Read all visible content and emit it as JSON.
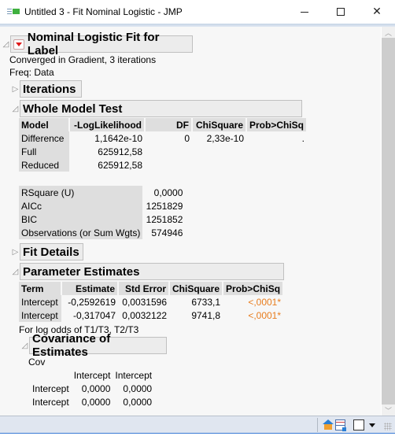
{
  "window": {
    "title": "Untitled 3 - Fit Nominal Logistic - JMP",
    "minimize_icon": "minimize-icon",
    "maximize_icon": "maximize-icon",
    "close_icon": "close-icon"
  },
  "report": {
    "main_title": "Nominal Logistic Fit for Label",
    "converged_text": "Converged in Gradient, 3 iterations",
    "freq_text": "Freq: Data",
    "iterations_title": "Iterations",
    "whole_model_test": {
      "title": "Whole Model Test",
      "columns": [
        "Model",
        "-LogLikelihood",
        "DF",
        "ChiSquare",
        "Prob>ChiSq"
      ],
      "rows": [
        {
          "model": "Difference",
          "loglik": "1,1642e-10",
          "df": "0",
          "chisq": "2,33e-10",
          "prob": "."
        },
        {
          "model": "Full",
          "loglik": "625912,58",
          "df": "",
          "chisq": "",
          "prob": ""
        },
        {
          "model": "Reduced",
          "loglik": "625912,58",
          "df": "",
          "chisq": "",
          "prob": ""
        }
      ],
      "stats": [
        {
          "label": "RSquare (U)",
          "value": "0,0000"
        },
        {
          "label": "AICc",
          "value": "1251829"
        },
        {
          "label": "BIC",
          "value": "1251852"
        },
        {
          "label": "Observations (or Sum Wgts)",
          "value": "574946"
        }
      ]
    },
    "fit_details_title": "Fit Details",
    "parameter_estimates": {
      "title": "Parameter Estimates",
      "columns": [
        "Term",
        "Estimate",
        "Std Error",
        "ChiSquare",
        "Prob>ChiSq"
      ],
      "rows": [
        {
          "term": "Intercept",
          "estimate": "-0,2592619",
          "stderr": "0,0031596",
          "chisq": "6733,1",
          "prob": "<,0001*"
        },
        {
          "term": "Intercept",
          "estimate": "-0,317047",
          "stderr": "0,0032122",
          "chisq": "9741,8",
          "prob": "<,0001*"
        }
      ],
      "footnote": "For log odds of T1/T3, T2/T3"
    },
    "covariance": {
      "title": "Covariance of Estimates",
      "label": "Cov",
      "columns": [
        "Intercept",
        "Intercept"
      ],
      "rows": [
        {
          "term": "Intercept",
          "values": [
            "0,0000",
            "0,0000"
          ]
        },
        {
          "term": "Intercept",
          "values": [
            "0,0000",
            "0,0000"
          ]
        }
      ]
    }
  },
  "colors": {
    "significant": "#e87d1e",
    "red_triangle": "#e01818"
  }
}
